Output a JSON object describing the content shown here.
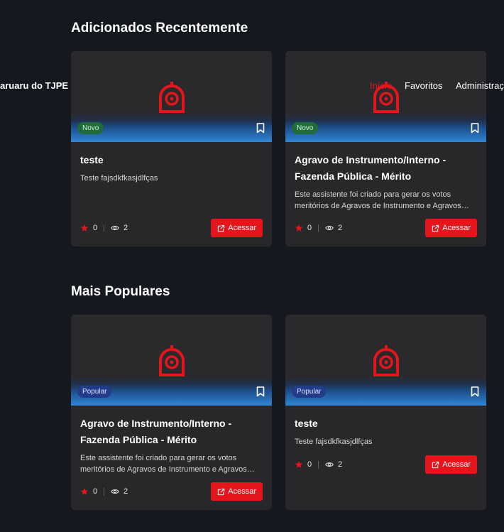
{
  "colors": {
    "background": "#16181f",
    "card": "#28282b",
    "accent": "#e6141b",
    "badge_novo": "#1f6b3a",
    "badge_popular": "#233c8a"
  },
  "navbar": {
    "brand": "aruaru do TJPE",
    "links": [
      {
        "label": "Início",
        "active": true
      },
      {
        "label": "Favoritos",
        "active": false
      },
      {
        "label": "Administraçã",
        "active": false
      }
    ]
  },
  "sections": {
    "recent": {
      "title": "Adicionados Recentemente",
      "cards": [
        {
          "badge": "Novo",
          "title": "teste",
          "description": "Teste fajsdkfkasjdlfças",
          "favorites": "0",
          "views": "2",
          "button": "Acessar"
        },
        {
          "badge": "Novo",
          "title": "Agravo de Instrumento/Interno - Fazenda Pública - Mérito",
          "description": "Este assistente foi criado para gerar os votos meritórios de Agravos de Instrumento e Agravos Internos",
          "favorites": "0",
          "views": "2",
          "button": "Acessar"
        }
      ]
    },
    "popular": {
      "title": "Mais Populares",
      "cards": [
        {
          "badge": "Popular",
          "title": "Agravo de Instrumento/Interno - Fazenda Pública - Mérito",
          "description": "Este assistente foi criado para gerar os votos meritórios de Agravos de Instrumento e Agravos Internos",
          "favorites": "0",
          "views": "2",
          "button": "Acessar"
        },
        {
          "badge": "Popular",
          "title": "teste",
          "description": "Teste fajsdkfkasjdlfças",
          "favorites": "0",
          "views": "2",
          "button": "Acessar"
        }
      ]
    }
  },
  "icons": {
    "logo": "tjpe-logo-icon",
    "bookmark": "bookmark-icon",
    "star": "star-icon",
    "views": "eye-icon",
    "open": "external-link-icon"
  }
}
